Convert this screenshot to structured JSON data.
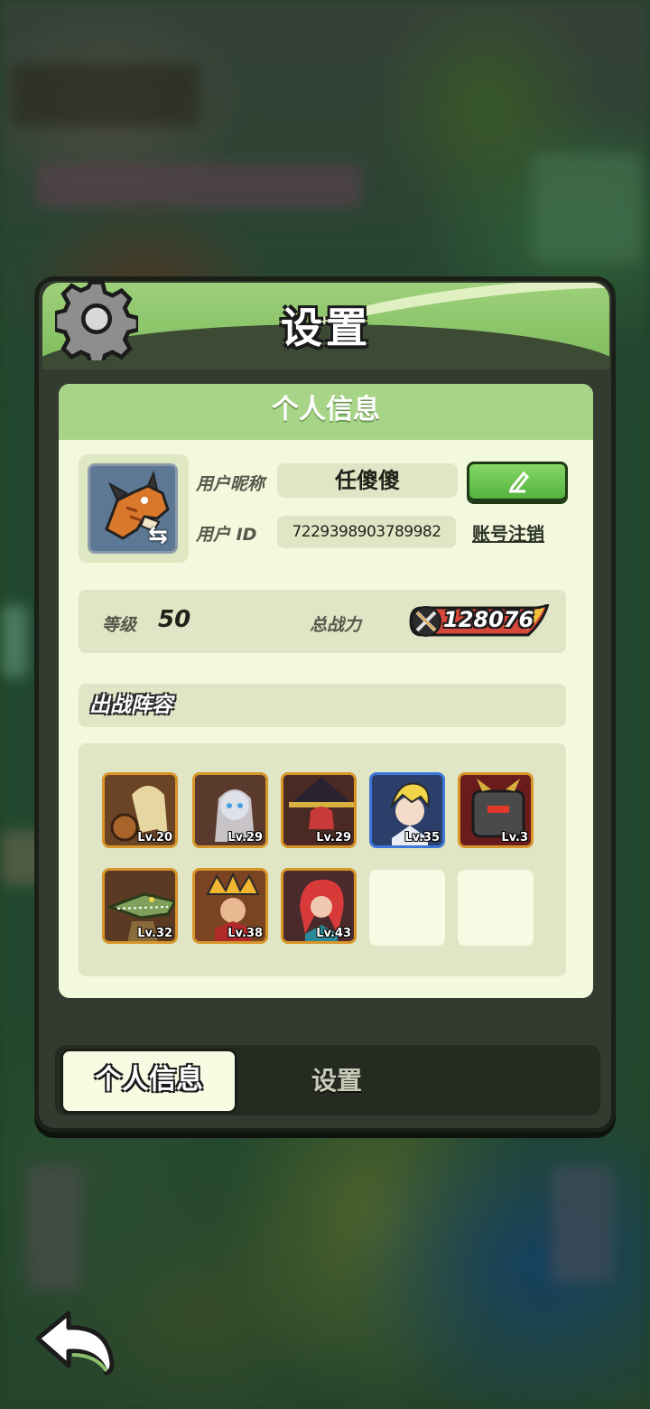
{
  "panel": {
    "title": "设置",
    "section_title": "个人信息"
  },
  "profile": {
    "nickname_label": "用户昵称",
    "nickname": "任傻傻",
    "id_label": "用户 ID",
    "id_value": "7229398903789982",
    "cancel_account": "账号注销"
  },
  "stats": {
    "level_label": "等级",
    "level_value": "50",
    "power_label": "总战力",
    "power_value": "128076"
  },
  "lineup": {
    "title": "出战阵容",
    "heroes": [
      {
        "level": "Lv.20",
        "frame": "orange"
      },
      {
        "level": "Lv.29",
        "frame": "orange"
      },
      {
        "level": "Lv.29",
        "frame": "orange"
      },
      {
        "level": "Lv.35",
        "frame": "blue"
      },
      {
        "level": "Lv.3",
        "frame": "orange"
      },
      {
        "level": "Lv.32",
        "frame": "orange"
      },
      {
        "level": "Lv.38",
        "frame": "orange"
      },
      {
        "level": "Lv.43",
        "frame": "orange"
      }
    ]
  },
  "tabs": {
    "active": "个人信息",
    "inactive": "设置"
  },
  "icons": {
    "settings": "gear-icon",
    "edit": "pencil-icon",
    "swap": "swap-icon",
    "back": "back-arrow-icon",
    "power": "crossed-swords-icon"
  },
  "colors": {
    "accent_green": "#7dbb5d",
    "card_bg": "#f3f9dc",
    "hero_frame_orange": "#d8952a",
    "hero_frame_blue": "#3d78d8"
  }
}
